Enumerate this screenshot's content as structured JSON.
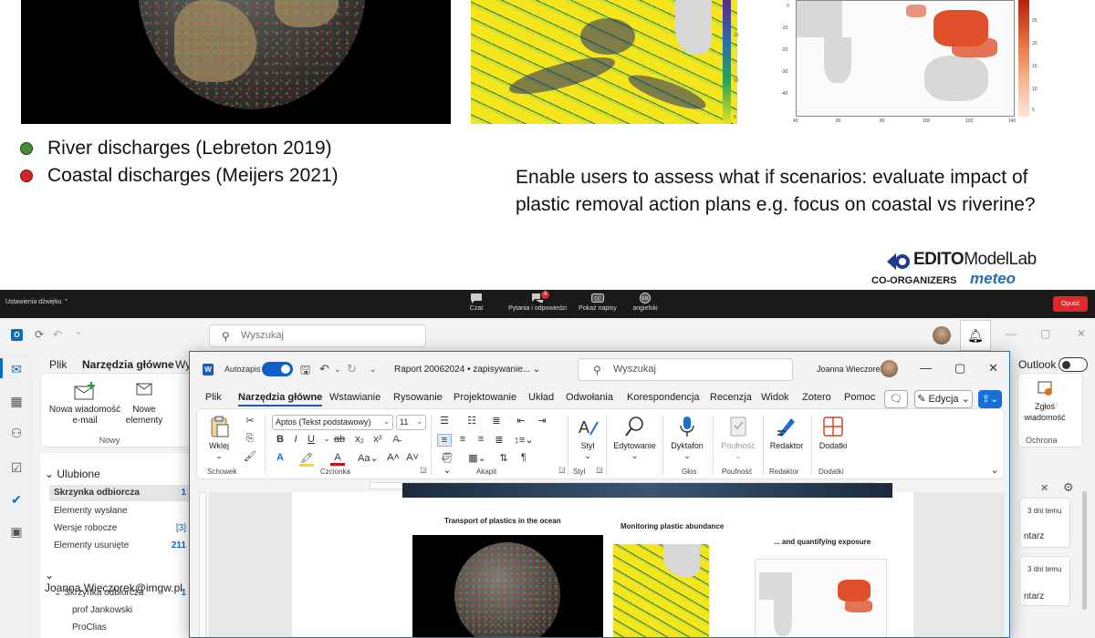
{
  "slide": {
    "cbar_ticks": [
      "15",
      "10",
      "5"
    ],
    "expo_colorbar_ticks": [
      "25",
      "20",
      "15",
      "10",
      "5"
    ],
    "expo_x_ticks": [
      "40",
      "60",
      "80",
      "100",
      "120",
      "140"
    ],
    "expo_y_ticks": [
      "0",
      "-10",
      "-20",
      "-30",
      "-40"
    ],
    "legend": [
      {
        "label": "River discharges (Lebreton 2019)",
        "color": "#3f8f2a"
      },
      {
        "label": "Coastal discharges (Meijers 2021)",
        "color": "#e02020"
      }
    ],
    "scenario_text": "Enable users to assess what if scenarios: evaluate impact of plastic removal action plans e.g. focus on coastal vs riverine?",
    "logo": {
      "brand": "EDITO",
      "brand_suffix": "ModelLab",
      "coorg": "CO-ORGANIZERS",
      "partner": "meteo"
    }
  },
  "zoom": {
    "sound_settings": "Ustawienia dźwięku",
    "items": [
      {
        "label": "Czat",
        "icon": "chat-icon"
      },
      {
        "label": "Pytania i odpowiedzi",
        "icon": "qa-icon",
        "badge": "4"
      },
      {
        "label": "Pokaż napisy",
        "icon": "captions-icon"
      },
      {
        "label": "angielski",
        "icon": "language-icon",
        "code": "EN"
      }
    ],
    "leave": "Opuść"
  },
  "outlook": {
    "search_placeholder": "Wyszukaj",
    "tabs": [
      "Plik",
      "Narzędzia główne",
      "Wy"
    ],
    "active_tab": "Narzędzia główne",
    "new_email": "Nowa wiadomość\ne-mail",
    "new_items": "Nowe\nelementy",
    "group_new": "Nowy",
    "right_outlook_label": "Outlook",
    "report_label": "Zgłoś\nwiadomość",
    "group_protection": "Ochrona",
    "favorites_header": "Ulubione",
    "favorites": [
      {
        "name": "Skrzynka odbiorcza",
        "count": "1",
        "selected": true
      },
      {
        "name": "Elementy wysłane",
        "count": ""
      },
      {
        "name": "Wersje robocze",
        "count": "[3]"
      },
      {
        "name": "Elementy usunięte",
        "count": "211"
      }
    ],
    "account_header": "Joanna.Wieczorek@imgw.pl",
    "account_folders": [
      {
        "name": "Skrzynka odbiorcza",
        "count": "1"
      },
      {
        "name": "prof Jankowski",
        "count": ""
      },
      {
        "name": "ProClias",
        "count": ""
      }
    ],
    "cards": [
      {
        "time": "3 dni temu",
        "text": "ntarz"
      },
      {
        "time": "3 dni temu",
        "text": "ntarz"
      }
    ]
  },
  "word": {
    "autosave": "Autozapis",
    "doc_name": "Raport 20062024 • zapisywanie...",
    "search_placeholder": "Wyszukaj",
    "user": "Joanna Wieczorek",
    "tabs": [
      "Plik",
      "Narzędzia główne",
      "Wstawianie",
      "Rysowanie",
      "Projektowanie",
      "Układ",
      "Odwołania",
      "Korespondencja",
      "Recenzja",
      "Widok",
      "Zotero",
      "Pomoc"
    ],
    "active_tab": "Narzędzia główne",
    "edit_mode": "Edycja",
    "paste": "Wklej",
    "font_name": "Aptos (Tekst podstawowy)",
    "font_size": "11",
    "style": "Styl",
    "editing": "Edytowanie",
    "dictate": "Dyktafon",
    "sensitivity": "Poufność",
    "editor": "Redaktor",
    "addins": "Dodatki",
    "groups": [
      "Schowek",
      "Czcionka",
      "Akapit",
      "Styl",
      "Głos",
      "Poufność",
      "Redaktor",
      "Dodatki"
    ],
    "page": {
      "title1": "Transport of plastics in the ocean",
      "title2": "Monitoring plastic abundance",
      "title3": "... and quantifying exposure"
    }
  }
}
